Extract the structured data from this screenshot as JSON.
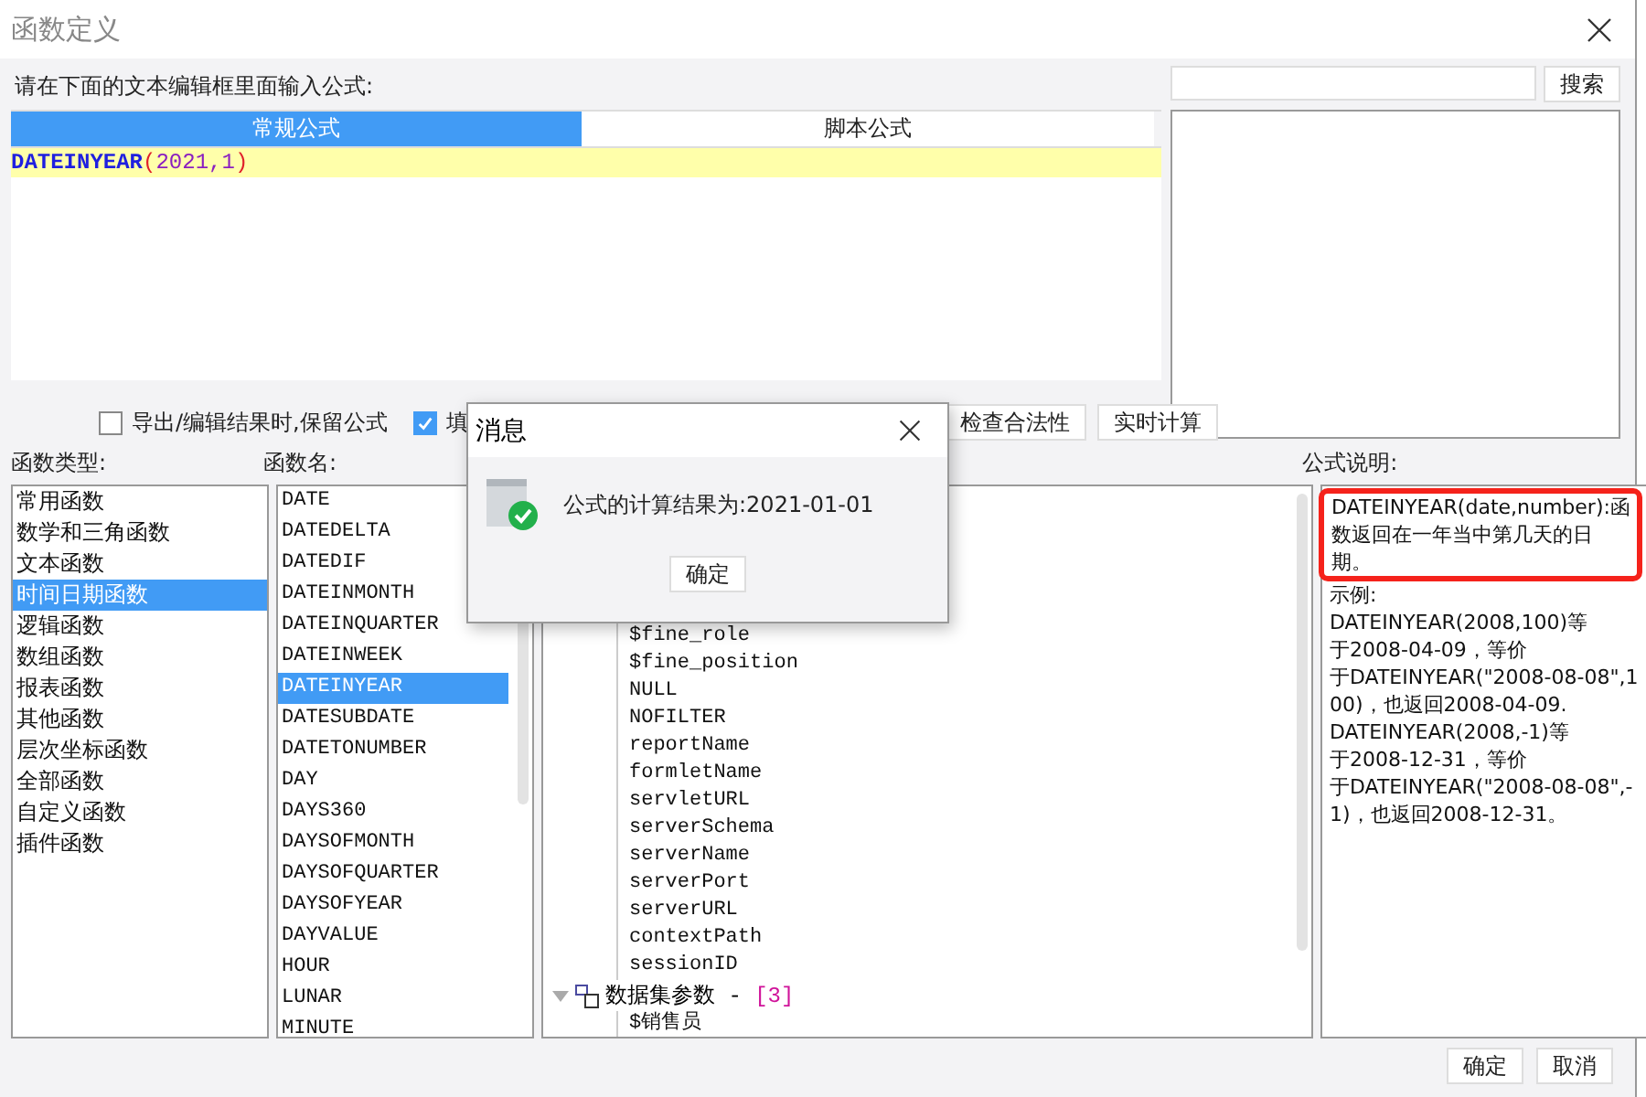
{
  "window": {
    "title": "函数定义"
  },
  "prompt": "请在下面的文本编辑框里面输入公式:",
  "search": {
    "button": "搜索"
  },
  "tabs": [
    {
      "label": "常规公式",
      "selected": true
    },
    {
      "label": "脚本公式",
      "selected": false
    }
  ],
  "editor": {
    "tokens": [
      {
        "text": "DATEINYEAR",
        "kind": "function"
      },
      {
        "text": "(",
        "kind": "paren"
      },
      {
        "text": "2021",
        "kind": "number"
      },
      {
        "text": ",",
        "kind": "punct"
      },
      {
        "text": "1",
        "kind": "number"
      },
      {
        "text": ")",
        "kind": "paren"
      }
    ]
  },
  "options": [
    {
      "label": "导出/编辑结果时,保留公式",
      "checked": false
    },
    {
      "label": "填",
      "checked": true
    }
  ],
  "actions": [
    "检查合法性",
    "实时计算"
  ],
  "function_types": {
    "label": "函数类型:",
    "items": [
      {
        "label": "常用函数",
        "selected": false
      },
      {
        "label": "数学和三角函数",
        "selected": false
      },
      {
        "label": "文本函数",
        "selected": false
      },
      {
        "label": "时间日期函数",
        "selected": true
      },
      {
        "label": "逻辑函数",
        "selected": false
      },
      {
        "label": "数组函数",
        "selected": false
      },
      {
        "label": "报表函数",
        "selected": false
      },
      {
        "label": "其他函数",
        "selected": false
      },
      {
        "label": "层次坐标函数",
        "selected": false
      },
      {
        "label": "全部函数",
        "selected": false
      },
      {
        "label": "自定义函数",
        "selected": false
      },
      {
        "label": "插件函数",
        "selected": false
      }
    ]
  },
  "function_names": {
    "label": "函数名:",
    "items": [
      {
        "label": "DATE",
        "selected": false
      },
      {
        "label": "DATEDELTA",
        "selected": false
      },
      {
        "label": "DATEDIF",
        "selected": false
      },
      {
        "label": "DATEINMONTH",
        "selected": false
      },
      {
        "label": "DATEINQUARTER",
        "selected": false
      },
      {
        "label": "DATEINWEEK",
        "selected": false
      },
      {
        "label": "DATEINYEAR",
        "selected": true
      },
      {
        "label": "DATESUBDATE",
        "selected": false
      },
      {
        "label": "DATETONUMBER",
        "selected": false
      },
      {
        "label": "DAY",
        "selected": false
      },
      {
        "label": "DAYS360",
        "selected": false
      },
      {
        "label": "DAYSOFMONTH",
        "selected": false
      },
      {
        "label": "DAYSOFQUARTER",
        "selected": false
      },
      {
        "label": "DAYSOFYEAR",
        "selected": false
      },
      {
        "label": "DAYVALUE",
        "selected": false
      },
      {
        "label": "HOUR",
        "selected": false
      },
      {
        "label": "LUNAR",
        "selected": false
      },
      {
        "label": "MINUTE",
        "selected": false
      }
    ]
  },
  "parameters": {
    "items": [
      "$fine_role",
      "$fine_position",
      "NULL",
      "NOFILTER",
      "reportName",
      "formletName",
      "servletURL",
      "serverSchema",
      "serverName",
      "serverPort",
      "serverURL",
      "contextPath",
      "sessionID"
    ],
    "groups": [
      {
        "label": "数据集参数 - ",
        "count": "[3]",
        "expanded": true,
        "children": [
          "$销售员"
        ]
      }
    ]
  },
  "description": {
    "label": "公式说明:",
    "summary": "DATEINYEAR(date,number):函数返回在一年当中第几天的日期。",
    "example_label": "示例:",
    "example_lines": [
      "DATEINYEAR(2008,100)等",
      "于2008-04-09，等价",
      "于DATEINYEAR(\"2008-08-08\",1",
      "00)，也返回2008-04-09.",
      "DATEINYEAR(2008,-1)等",
      "于2008-12-31，等价",
      "于DATEINYEAR(\"2008-08-08\",-",
      "1)，也返回2008-12-31。"
    ]
  },
  "footer": [
    "确定",
    "取消"
  ],
  "message": {
    "title": "消息",
    "text": "公式的计算结果为:2021-01-01",
    "button": "确定"
  }
}
